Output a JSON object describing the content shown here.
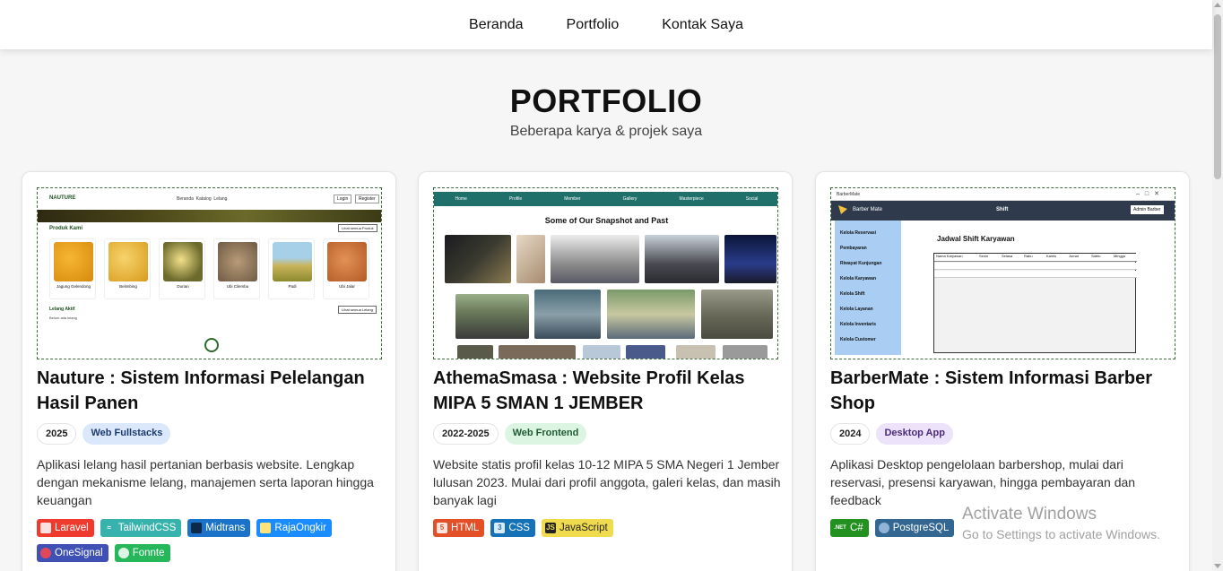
{
  "nav": {
    "items": [
      "Beranda",
      "Portfolio",
      "Kontak Saya"
    ]
  },
  "section": {
    "title": "PORTFOLIO",
    "subtitle": "Beberapa karya & projek saya"
  },
  "projects": [
    {
      "title": "Nauture : Sistem Informasi Pelelangan Hasil Panen",
      "year": "2025",
      "category": "Web Fullstacks",
      "category_bg": "#dbe8fb",
      "category_fg": "#1d3b6e",
      "description": "Aplikasi lelang hasil pertanian berbasis website. Lengkap dengan mekanisme lelang, manajemen serta laporan hingga keuangan",
      "techs": [
        {
          "name": "Laravel",
          "color": "#ef3b2d",
          "icon": "laravel-icon"
        },
        {
          "name": "TailwindCSS",
          "color": "#38b2ac",
          "icon": "tailwind-icon"
        },
        {
          "name": "Midtrans",
          "color": "#1a73c8",
          "icon": "midtrans-icon"
        },
        {
          "name": "RajaOngkir",
          "color": "#1a8cff",
          "icon": "rajaongkir-icon"
        },
        {
          "name": "OneSignal",
          "color": "#3f51b5",
          "icon": "onesignal-icon"
        },
        {
          "name": "Fonnte",
          "color": "#25b75a",
          "icon": "whatsapp-icon"
        }
      ],
      "preview": {
        "brand": "NAUTURE",
        "menu": "Beranda  Katalog  Lelang",
        "login": "Login",
        "register": "Register",
        "section": "Produk Kami",
        "see_all": "Lihat semua Produk",
        "products": [
          "Jagung Gelendong",
          "Belimbing",
          "Durian",
          "Ubi Cilembu",
          "Padi",
          "Ubi Jalar"
        ],
        "auction": "Lelang Aktif",
        "auction_sub": "Belum ada lelang",
        "see_all2": "Lihat semua Lelang"
      }
    },
    {
      "title": "AthemaSmasa : Website Profil Kelas MIPA 5 SMAN 1 JEMBER",
      "year": "2022-2025",
      "category": "Web Frontend",
      "category_bg": "#dcf5e3",
      "category_fg": "#1e5b31",
      "description": "Website statis profil kelas 10-12 MIPA 5 SMA Negeri 1 Jember lulusan 2023. Mulai dari profil anggota, galeri kelas, dan masih banyak lagi",
      "techs": [
        {
          "name": "HTML",
          "color": "#e34f26",
          "icon": "html5-icon"
        },
        {
          "name": "CSS",
          "color": "#1572b6",
          "icon": "css3-icon"
        },
        {
          "name": "JavaScript",
          "color": "#f0db4f",
          "icon": "javascript-icon",
          "text": "#222"
        }
      ],
      "preview": {
        "menu": [
          "Home",
          "Profile",
          "Member",
          "Gallery",
          "Masterpiece",
          "Social"
        ],
        "heading": "Some of Our Snapshot and Past"
      }
    },
    {
      "title": "BarberMate : Sistem Informasi Barber Shop",
      "year": "2024",
      "category": "Desktop App",
      "category_bg": "#ece3fb",
      "category_fg": "#4a2a7a",
      "description": "Aplikasi Desktop pengelolaan barbershop, mulai dari reservasi, presensi karyawan, hingga pembayaran dan feedback",
      "techs": [
        {
          "name": "C#",
          "color": "#239120",
          "icon": "dotnet-icon"
        },
        {
          "name": "PostgreSQL",
          "color": "#336791",
          "icon": "postgresql-icon"
        }
      ],
      "preview": {
        "window_title": "BarberMate",
        "app_name": "Barber Mate",
        "page": "Shift",
        "admin": "Admin Barber",
        "menu": [
          "Kelola Reservasi",
          "Pembayaran",
          "Riwayat Kunjungan",
          "Kelola Karyawan",
          "Kelola Shift",
          "Kelola Layanan",
          "Kelola Inventaris",
          "Kelola Customer"
        ],
        "heading": "Jadwal Shift Karyawan",
        "columns": [
          "Nama Karyawan",
          "Senin",
          "Selasa",
          "Rabu",
          "Kamis",
          "Jumat",
          "Sabtu",
          "Minggu"
        ]
      }
    }
  ],
  "watermark": {
    "line1": "Activate Windows",
    "line2": "Go to Settings to activate Windows."
  },
  "colors": {
    "nav_bg": "#ffffff",
    "page_bg": "#f6f6f6",
    "card_bg": "#ffffff"
  }
}
